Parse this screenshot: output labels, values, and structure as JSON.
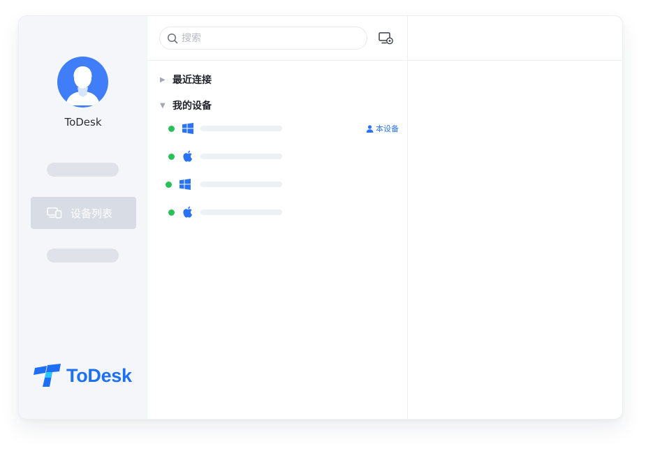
{
  "sidebar": {
    "username": "ToDesk",
    "nav_active_label": "设备列表",
    "brand": "ToDesk"
  },
  "search": {
    "placeholder": "搜索"
  },
  "groups": {
    "recent": "最近连接",
    "mine": "我的设备"
  },
  "devices": [
    {
      "os": "windows",
      "status": "online",
      "tag": "本设备"
    },
    {
      "os": "apple",
      "status": "online"
    },
    {
      "os": "windows",
      "status": "online"
    },
    {
      "os": "apple",
      "status": "online"
    }
  ],
  "colors": {
    "accent": "#1f6ff5",
    "online": "#27c15a",
    "avatar": "#3f7ef8"
  }
}
